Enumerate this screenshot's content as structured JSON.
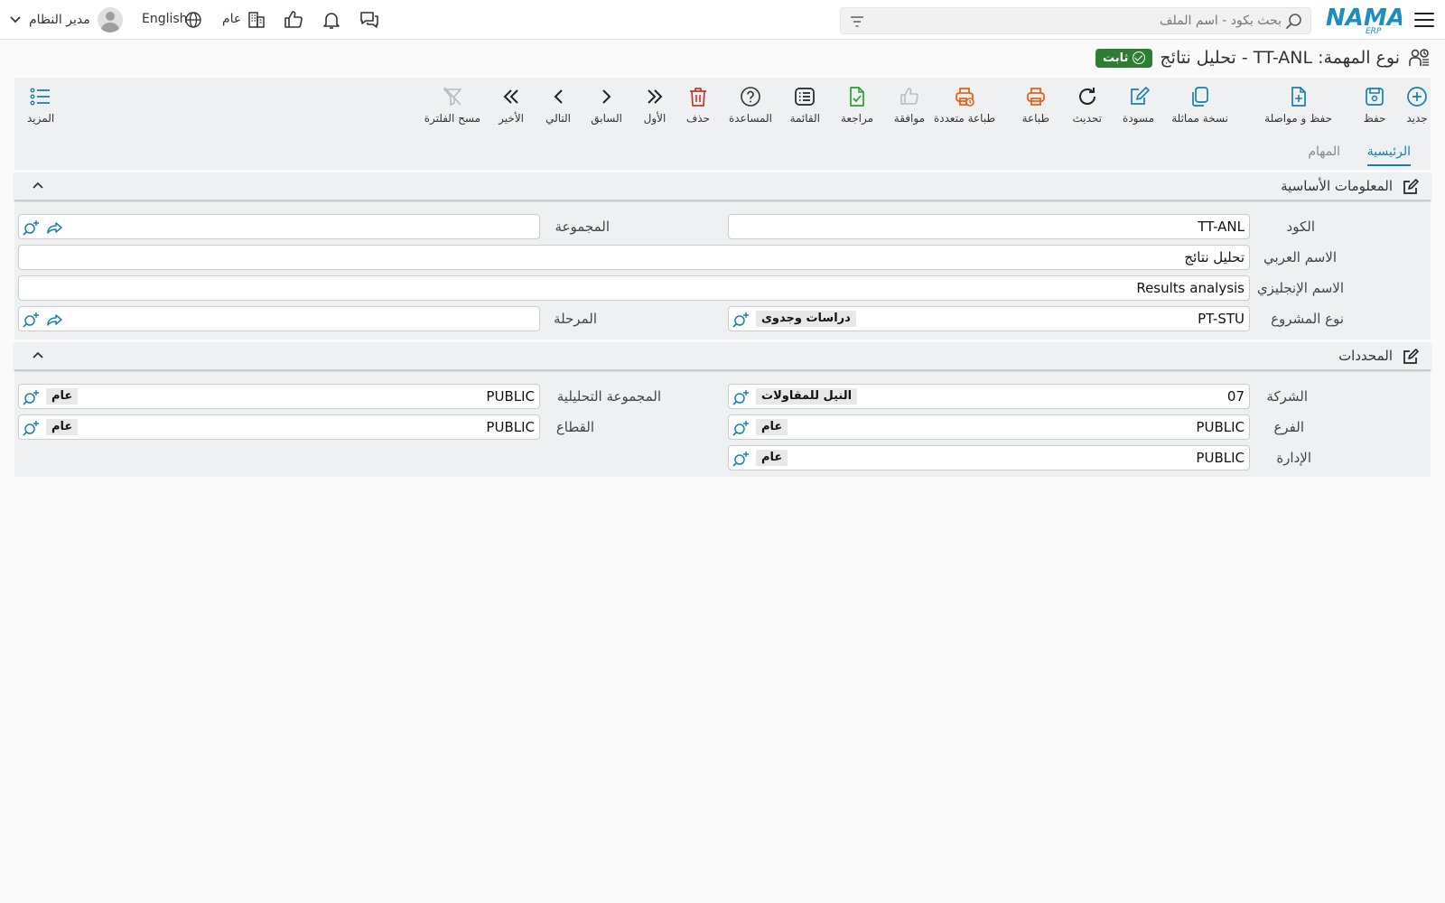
{
  "topbar": {
    "search_placeholder": "بحث بكود - اسم الملف",
    "company_label": "عام",
    "language_label": "English",
    "user_name": "مدير النظام"
  },
  "title": {
    "text": "نوع المهمة: TT-ANL - تحليل نتائج",
    "status_badge": "ثابت"
  },
  "toolbar": {
    "new": "جديد",
    "save": "حفظ",
    "save_continue": "حفظ و مواصلة",
    "duplicate": "نسخة مماثلة",
    "draft": "مسودة",
    "refresh": "تحديث",
    "print": "طباعة",
    "multi_print": "طباعة متعددة",
    "approve": "موافقة",
    "review": "مراجعة",
    "list": "القائمة",
    "help": "المساعدة",
    "delete": "حذف",
    "first": "الأول",
    "previous": "السابق",
    "next": "التالي",
    "last": "الأخير",
    "clear_filter": "مسح الفلترة",
    "more": "المزيد"
  },
  "tabs": {
    "main": "الرئيسية",
    "tasks": "المهام"
  },
  "basic_info": {
    "title": "المعلومات الأساسية",
    "code_label": "الكود",
    "code_value": "TT-ANL",
    "group_label": "المجموعة",
    "group_value": "",
    "arabic_name_label": "الاسم العربي",
    "arabic_name_value": "تحليل نتائج",
    "english_name_label": "الاسم الإنجليزي",
    "english_name_value": "Results analysis",
    "project_type_label": "نوع المشروع",
    "project_type_code": "PT-STU",
    "project_type_name": "دراسات وجدوى",
    "stage_label": "المرحلة",
    "stage_value": ""
  },
  "dimensions": {
    "title": "المحددات",
    "company_label": "الشركة",
    "company_code": "07",
    "company_name": "النيل للمقاولات",
    "analytic_group_label": "المجموعة التحليلية",
    "analytic_group_code": "PUBLIC",
    "analytic_group_name": "عام",
    "branch_label": "الفرع",
    "branch_code": "PUBLIC",
    "branch_name": "عام",
    "sector_label": "القطاع",
    "sector_code": "PUBLIC",
    "sector_name": "عام",
    "department_label": "الإدارة",
    "department_code": "PUBLIC",
    "department_name": "عام"
  },
  "colors": {
    "accent": "#1a7fa8",
    "status_green": "#2e7d32",
    "print_orange": "#e8611a",
    "delete_red": "#c0392b",
    "review_green": "#2e9b3a"
  }
}
